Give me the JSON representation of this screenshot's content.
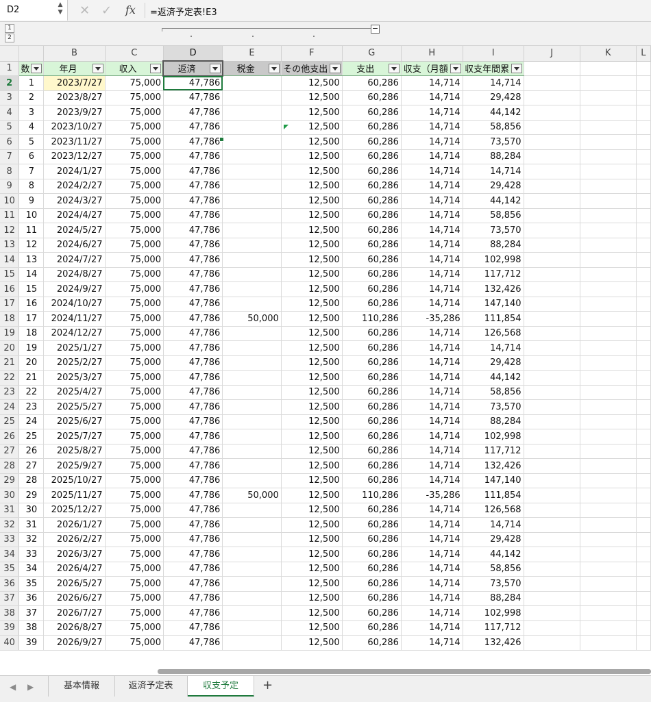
{
  "name_box": "D2",
  "formula": "=返済予定表!E3",
  "outline_levels": [
    "1",
    "2"
  ],
  "columns": [
    "",
    "B",
    "C",
    "D",
    "E",
    "F",
    "G",
    "H",
    "I",
    "J",
    "K",
    "L"
  ],
  "headers": [
    {
      "label": "数",
      "style": "green"
    },
    {
      "label": "年月",
      "style": "green"
    },
    {
      "label": "収入",
      "style": "green"
    },
    {
      "label": "返済",
      "style": "grey"
    },
    {
      "label": "税金",
      "style": "grey"
    },
    {
      "label": "その他支出",
      "style": "grey"
    },
    {
      "label": "支出",
      "style": "green"
    },
    {
      "label": "収支（月額",
      "style": "green"
    },
    {
      "label": "収支年間累",
      "style": "green"
    }
  ],
  "rows": [
    [
      "2",
      "1",
      "2023/7/27",
      "75,000",
      "47,786",
      "",
      "12,500",
      "60,286",
      "14,714",
      "14,714"
    ],
    [
      "3",
      "2",
      "2023/8/27",
      "75,000",
      "47,786",
      "",
      "12,500",
      "60,286",
      "14,714",
      "29,428"
    ],
    [
      "4",
      "3",
      "2023/9/27",
      "75,000",
      "47,786",
      "",
      "12,500",
      "60,286",
      "14,714",
      "44,142"
    ],
    [
      "5",
      "4",
      "2023/10/27",
      "75,000",
      "47,786",
      "",
      "12,500",
      "60,286",
      "14,714",
      "58,856"
    ],
    [
      "6",
      "5",
      "2023/11/27",
      "75,000",
      "47,786",
      "",
      "12,500",
      "60,286",
      "14,714",
      "73,570"
    ],
    [
      "7",
      "6",
      "2023/12/27",
      "75,000",
      "47,786",
      "",
      "12,500",
      "60,286",
      "14,714",
      "88,284"
    ],
    [
      "8",
      "7",
      "2024/1/27",
      "75,000",
      "47,786",
      "",
      "12,500",
      "60,286",
      "14,714",
      "14,714"
    ],
    [
      "9",
      "8",
      "2024/2/27",
      "75,000",
      "47,786",
      "",
      "12,500",
      "60,286",
      "14,714",
      "29,428"
    ],
    [
      "10",
      "9",
      "2024/3/27",
      "75,000",
      "47,786",
      "",
      "12,500",
      "60,286",
      "14,714",
      "44,142"
    ],
    [
      "11",
      "10",
      "2024/4/27",
      "75,000",
      "47,786",
      "",
      "12,500",
      "60,286",
      "14,714",
      "58,856"
    ],
    [
      "12",
      "11",
      "2024/5/27",
      "75,000",
      "47,786",
      "",
      "12,500",
      "60,286",
      "14,714",
      "73,570"
    ],
    [
      "13",
      "12",
      "2024/6/27",
      "75,000",
      "47,786",
      "",
      "12,500",
      "60,286",
      "14,714",
      "88,284"
    ],
    [
      "14",
      "13",
      "2024/7/27",
      "75,000",
      "47,786",
      "",
      "12,500",
      "60,286",
      "14,714",
      "102,998"
    ],
    [
      "15",
      "14",
      "2024/8/27",
      "75,000",
      "47,786",
      "",
      "12,500",
      "60,286",
      "14,714",
      "117,712"
    ],
    [
      "16",
      "15",
      "2024/9/27",
      "75,000",
      "47,786",
      "",
      "12,500",
      "60,286",
      "14,714",
      "132,426"
    ],
    [
      "17",
      "16",
      "2024/10/27",
      "75,000",
      "47,786",
      "",
      "12,500",
      "60,286",
      "14,714",
      "147,140"
    ],
    [
      "18",
      "17",
      "2024/11/27",
      "75,000",
      "47,786",
      "50,000",
      "12,500",
      "110,286",
      "-35,286",
      "111,854"
    ],
    [
      "19",
      "18",
      "2024/12/27",
      "75,000",
      "47,786",
      "",
      "12,500",
      "60,286",
      "14,714",
      "126,568"
    ],
    [
      "20",
      "19",
      "2025/1/27",
      "75,000",
      "47,786",
      "",
      "12,500",
      "60,286",
      "14,714",
      "14,714"
    ],
    [
      "21",
      "20",
      "2025/2/27",
      "75,000",
      "47,786",
      "",
      "12,500",
      "60,286",
      "14,714",
      "29,428"
    ],
    [
      "22",
      "21",
      "2025/3/27",
      "75,000",
      "47,786",
      "",
      "12,500",
      "60,286",
      "14,714",
      "44,142"
    ],
    [
      "23",
      "22",
      "2025/4/27",
      "75,000",
      "47,786",
      "",
      "12,500",
      "60,286",
      "14,714",
      "58,856"
    ],
    [
      "24",
      "23",
      "2025/5/27",
      "75,000",
      "47,786",
      "",
      "12,500",
      "60,286",
      "14,714",
      "73,570"
    ],
    [
      "25",
      "24",
      "2025/6/27",
      "75,000",
      "47,786",
      "",
      "12,500",
      "60,286",
      "14,714",
      "88,284"
    ],
    [
      "26",
      "25",
      "2025/7/27",
      "75,000",
      "47,786",
      "",
      "12,500",
      "60,286",
      "14,714",
      "102,998"
    ],
    [
      "27",
      "26",
      "2025/8/27",
      "75,000",
      "47,786",
      "",
      "12,500",
      "60,286",
      "14,714",
      "117,712"
    ],
    [
      "28",
      "27",
      "2025/9/27",
      "75,000",
      "47,786",
      "",
      "12,500",
      "60,286",
      "14,714",
      "132,426"
    ],
    [
      "29",
      "28",
      "2025/10/27",
      "75,000",
      "47,786",
      "",
      "12,500",
      "60,286",
      "14,714",
      "147,140"
    ],
    [
      "30",
      "29",
      "2025/11/27",
      "75,000",
      "47,786",
      "50,000",
      "12,500",
      "110,286",
      "-35,286",
      "111,854"
    ],
    [
      "31",
      "30",
      "2025/12/27",
      "75,000",
      "47,786",
      "",
      "12,500",
      "60,286",
      "14,714",
      "126,568"
    ],
    [
      "32",
      "31",
      "2026/1/27",
      "75,000",
      "47,786",
      "",
      "12,500",
      "60,286",
      "14,714",
      "14,714"
    ],
    [
      "33",
      "32",
      "2026/2/27",
      "75,000",
      "47,786",
      "",
      "12,500",
      "60,286",
      "14,714",
      "29,428"
    ],
    [
      "34",
      "33",
      "2026/3/27",
      "75,000",
      "47,786",
      "",
      "12,500",
      "60,286",
      "14,714",
      "44,142"
    ],
    [
      "35",
      "34",
      "2026/4/27",
      "75,000",
      "47,786",
      "",
      "12,500",
      "60,286",
      "14,714",
      "58,856"
    ],
    [
      "36",
      "35",
      "2026/5/27",
      "75,000",
      "47,786",
      "",
      "12,500",
      "60,286",
      "14,714",
      "73,570"
    ],
    [
      "37",
      "36",
      "2026/6/27",
      "75,000",
      "47,786",
      "",
      "12,500",
      "60,286",
      "14,714",
      "88,284"
    ],
    [
      "38",
      "37",
      "2026/7/27",
      "75,000",
      "47,786",
      "",
      "12,500",
      "60,286",
      "14,714",
      "102,998"
    ],
    [
      "39",
      "38",
      "2026/8/27",
      "75,000",
      "47,786",
      "",
      "12,500",
      "60,286",
      "14,714",
      "117,712"
    ],
    [
      "40",
      "39",
      "2026/9/27",
      "75,000",
      "47,786",
      "",
      "12,500",
      "60,286",
      "14,714",
      "132,426"
    ]
  ],
  "sheet_tabs": [
    {
      "label": "基本情報",
      "active": false
    },
    {
      "label": "返済予定表",
      "active": false
    },
    {
      "label": "収支予定",
      "active": true
    }
  ],
  "colors": {
    "accent": "#1f7a3d",
    "header_green": "#d8f5d8",
    "header_grey": "#c9c9c9"
  }
}
